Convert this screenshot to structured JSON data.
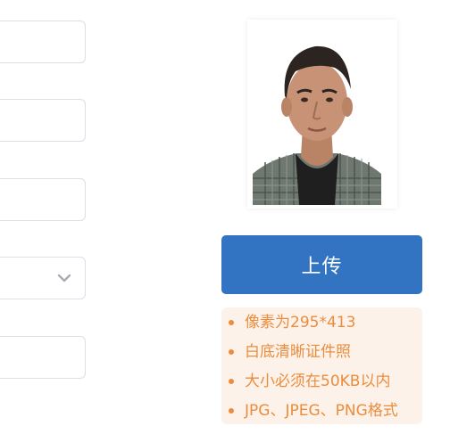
{
  "form": {
    "fields": [
      "",
      "",
      "",
      "",
      ""
    ],
    "select_icon": "chevron-down-icon"
  },
  "photo": {
    "icon": "id-photo-portrait"
  },
  "upload": {
    "button_label": "上传"
  },
  "requirements": {
    "items": [
      "像素为295*413",
      "白底清晰证件照",
      "大小必须在50KB以内",
      "JPG、JPEG、PNG格式"
    ]
  },
  "colors": {
    "primary": "#3374c2",
    "tip_text": "#eb8d3d",
    "tip_bg": "#fdf2ea",
    "border": "#dcdfe6"
  }
}
